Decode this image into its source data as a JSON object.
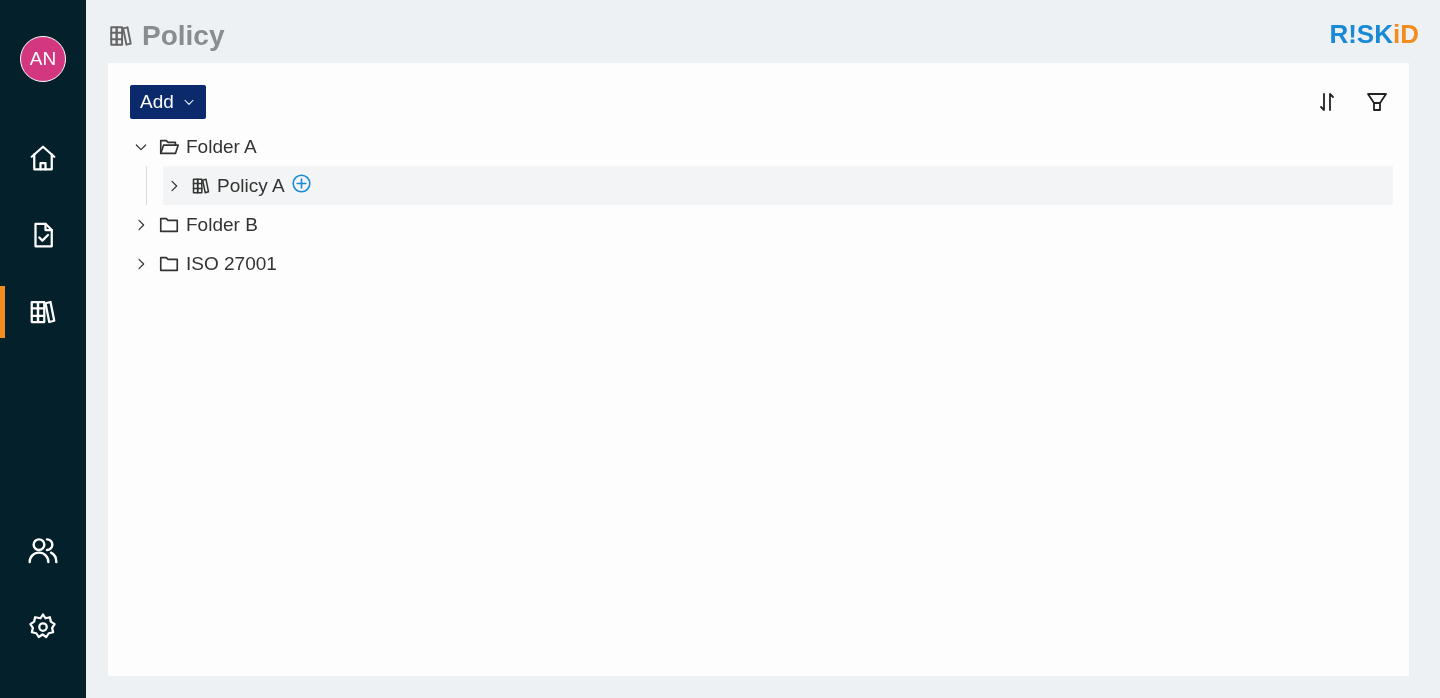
{
  "sidebar": {
    "avatar": "AN",
    "nav": [
      {
        "kind": "home",
        "selected": false
      },
      {
        "kind": "checklist",
        "selected": false
      },
      {
        "kind": "library",
        "selected": true
      },
      {
        "kind": "users",
        "selected": false
      },
      {
        "kind": "settings",
        "selected": false
      }
    ]
  },
  "header": {
    "title": "Policy",
    "logo": {
      "part_1": "R!SK",
      "part_2": "iD"
    }
  },
  "toolbar": {
    "add_button": "Add"
  },
  "tree": [
    {
      "kind": "folder",
      "label": "Folder A",
      "expanded": true,
      "highlighted": false,
      "children": [
        {
          "kind": "policy",
          "label": "Policy A",
          "expanded": false,
          "highlighted": true
        }
      ]
    },
    {
      "kind": "folder",
      "label": "Folder B",
      "expanded": false,
      "highlighted": false
    },
    {
      "kind": "folder",
      "label": "ISO 27001",
      "expanded": false,
      "highlighted": false
    }
  ]
}
